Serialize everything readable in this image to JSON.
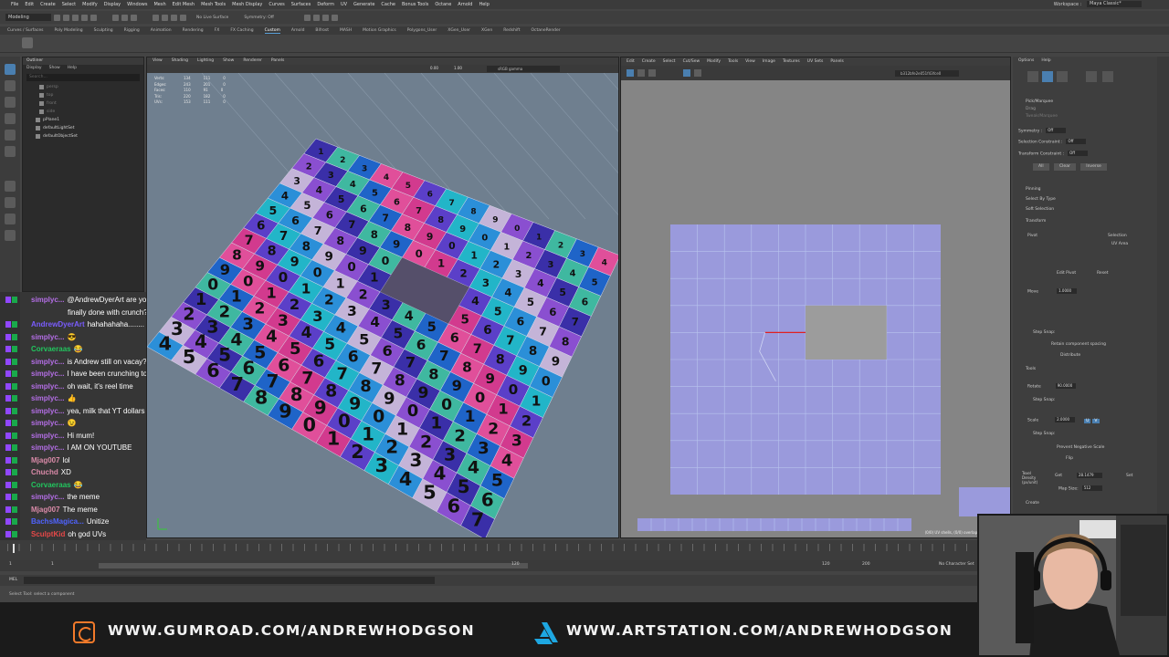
{
  "menubar": {
    "items": [
      "File",
      "Edit",
      "Create",
      "Select",
      "Modify",
      "Display",
      "Windows",
      "Mesh",
      "Edit Mesh",
      "Mesh Tools",
      "Mesh Display",
      "Curves",
      "Surfaces",
      "Deform",
      "UV",
      "Generate",
      "Cache",
      "Bonus Tools",
      "Octane",
      "Arnold",
      "Help"
    ],
    "workspace_label": "Workspace :",
    "workspace_value": "Maya Classic*"
  },
  "statusline": {
    "mode": "Modeling",
    "live_surface": "No Live Surface",
    "symmetry": "Symmetry: Off"
  },
  "shelf_tabs": [
    "Curves / Surfaces",
    "Poly Modeling",
    "Sculpting",
    "Rigging",
    "Animation",
    "Rendering",
    "FX",
    "FX Caching",
    "Custom",
    "Arnold",
    "Bifrost",
    "MASH",
    "Motion Graphics",
    "Polygons_User",
    "XGen_User",
    "XGen",
    "Redshift",
    "OctaneRender"
  ],
  "shelf_active": "Custom",
  "outliner": {
    "title": "Outliner",
    "menu": [
      "Display",
      "Show",
      "Help"
    ],
    "search_placeholder": "Search...",
    "items": [
      "persp",
      "top",
      "front",
      "side",
      "pPlane1",
      "defaultLightSet",
      "defaultObjectSet"
    ]
  },
  "viewport": {
    "menu": [
      "View",
      "Shading",
      "Lighting",
      "Show",
      "Renderer",
      "Panels"
    ],
    "exposure": "0.00",
    "gamma": "1.00",
    "color_space": "sRGB gamma",
    "hud": [
      {
        "label": "Verts:",
        "a": "134",
        "b": "111",
        "c": "0"
      },
      {
        "label": "Edges:",
        "a": "243",
        "b": "201",
        "c": "0"
      },
      {
        "label": "Faces:",
        "a": "110",
        "b": "91",
        "c": "0"
      },
      {
        "label": "Tris:",
        "a": "220",
        "b": "182",
        "c": "0"
      },
      {
        "label": "UVs:",
        "a": "153",
        "b": "111",
        "c": "0"
      }
    ],
    "digits": [
      "1",
      "2",
      "3",
      "4",
      "5",
      "6",
      "7",
      "8",
      "9",
      "0"
    ]
  },
  "uv_editor": {
    "menu": [
      "Edit",
      "Create",
      "Select",
      "Cut/Sew",
      "Modify",
      "Tools",
      "View",
      "Image",
      "Textures",
      "UV Sets",
      "Panels"
    ],
    "texture_dropdown": "b312bfe2e051f43fce0",
    "status": "(0/0) UV shells, (0/0) overlapping UVs, (0/0)"
  },
  "uv_toolkit": {
    "header": [
      "Options",
      "Help"
    ],
    "pick_marquee": "Pick/Marquee",
    "drag": "Drag",
    "tweak_marquee": "Tweak/Marquee",
    "symmetry": "Symmetry :",
    "symmetry_value": "Off",
    "selection_constraint": "Selection Constraint :",
    "transform_constraint": "Transform Constraint :",
    "off": "Off",
    "buttons": [
      "All",
      "Clear",
      "Inverse"
    ],
    "sections": [
      "Pinning",
      "Select By Type",
      "Soft Selection",
      "Transform"
    ],
    "pivot_label": "Pivot",
    "pivot_selection": "Selection",
    "pivot_uv_area": "UV Area",
    "edit_pivot": "Edit Pivot",
    "reset": "Reset",
    "move_label": "Move",
    "move_value": "1.0000",
    "step_snap": "Step Snap:",
    "retain_spacing": "Retain component spacing",
    "distribute": "Distribute",
    "tools": "Tools",
    "rotate_label": "Rotate",
    "rotate_value": "90.0000",
    "scale_label": "Scale",
    "scale_value": "2.0000",
    "prevent_negative": "Prevent Negative Scale",
    "flip": "Flip",
    "texel_density": "Texel Density (px/unit)",
    "get": "Get",
    "texel_value": "28.1479",
    "set": "Set",
    "map_size": "Map Size:",
    "map_size_value": "512",
    "create": "Create",
    "u": "U",
    "v": "V"
  },
  "chat": [
    {
      "user": "simplyc...",
      "msg": "@AndrewDyerArt are you",
      "color": "#b46ee6"
    },
    {
      "user": "",
      "msg": "finally done with crunch?",
      "color": "#b46ee6"
    },
    {
      "user": "AndrewDyerArt",
      "msg": "hahahahaha........ no",
      "color": "#7a5cff"
    },
    {
      "user": "simplyc...",
      "msg": "😎",
      "color": "#b46ee6"
    },
    {
      "user": "Corvaeraas",
      "msg": "😂",
      "color": "#22c55e"
    },
    {
      "user": "simplyc...",
      "msg": "is Andrew still on vacay?",
      "color": "#b46ee6"
    },
    {
      "user": "simplyc...",
      "msg": "I have been crunching too",
      "color": "#b46ee6"
    },
    {
      "user": "simplyc...",
      "msg": "oh wait, it's reel time",
      "color": "#b46ee6"
    },
    {
      "user": "simplyc...",
      "msg": "👍",
      "color": "#b46ee6"
    },
    {
      "user": "simplyc...",
      "msg": "yea, milk that YT dollars",
      "color": "#b46ee6"
    },
    {
      "user": "simplyc...",
      "msg": "😉",
      "color": "#b46ee6"
    },
    {
      "user": "simplyc...",
      "msg": "Hi mum!",
      "color": "#b46ee6"
    },
    {
      "user": "simplyc...",
      "msg": "I AM ON YOUTUBE",
      "color": "#b46ee6"
    },
    {
      "user": "Mjag007",
      "msg": "lol",
      "color": "#d98aa8"
    },
    {
      "user": "Chuchd",
      "msg": "XD",
      "color": "#d98aa8"
    },
    {
      "user": "Corvaeraas",
      "msg": "😂",
      "color": "#22c55e"
    },
    {
      "user": "simplyc...",
      "msg": "the meme",
      "color": "#b46ee6"
    },
    {
      "user": "Mjag007",
      "msg": "The meme",
      "color": "#d98aa8"
    },
    {
      "user": "BachsMagica...",
      "msg": "Unitize",
      "color": "#4f63ff"
    },
    {
      "user": "SculptKid",
      "msg": "oh god UVs",
      "color": "#e64848"
    }
  ],
  "time": {
    "start": "1",
    "current": "1",
    "range_end": "120",
    "end": "120",
    "max": "200",
    "character_set": "No Character Set"
  },
  "mel": {
    "label": "MEL"
  },
  "helpline": "Select Tool: select a component",
  "banner": {
    "gumroad": "WWW.GUMROAD.COM/ANDREWHODGSON",
    "artstation": "WWW.ARTSTATION.COM/ANDREWHODGSON"
  },
  "colors": {
    "gumroad_orange": "#f37a2a",
    "artstation_blue": "#1ea7e1",
    "uv_shell": "#9a9adc",
    "uv_selected_edge": "#e02020",
    "viewport_bg": "#6f7f8f"
  },
  "icons": {
    "gumroad": "gumroad-logo-icon",
    "artstation": "artstation-logo-icon",
    "play": "play-icon",
    "select_tool": "select-arrow-icon"
  }
}
